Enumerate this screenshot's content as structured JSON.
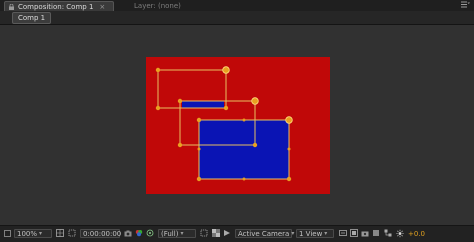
{
  "tabs": {
    "composition_label": "Composition: Comp 1",
    "layer_label": "Layer: (none)"
  },
  "comp_tab_label": "Comp 1",
  "toolbar": {
    "magnification": "100%",
    "timecode": "0:00:00:00",
    "resolution": "(Full)",
    "camera": "Active Camera",
    "view_layout": "1 View",
    "exposure_value": "+0.0"
  },
  "colors": {
    "comp_background": "#c00808",
    "solid_layer": "#0a14b4",
    "bounding_box": "#e8c060",
    "viewer_background": "#313131"
  },
  "icons": [
    "lock-icon",
    "panel-menu-icon",
    "grid-icon",
    "mask-icon",
    "camera-icon",
    "color-channel-icon",
    "region-of-interest-icon",
    "transparency-grid-icon",
    "fast-preview-icon",
    "pixel-aspect-icon",
    "flowchart-icon",
    "exposure-icon"
  ]
}
